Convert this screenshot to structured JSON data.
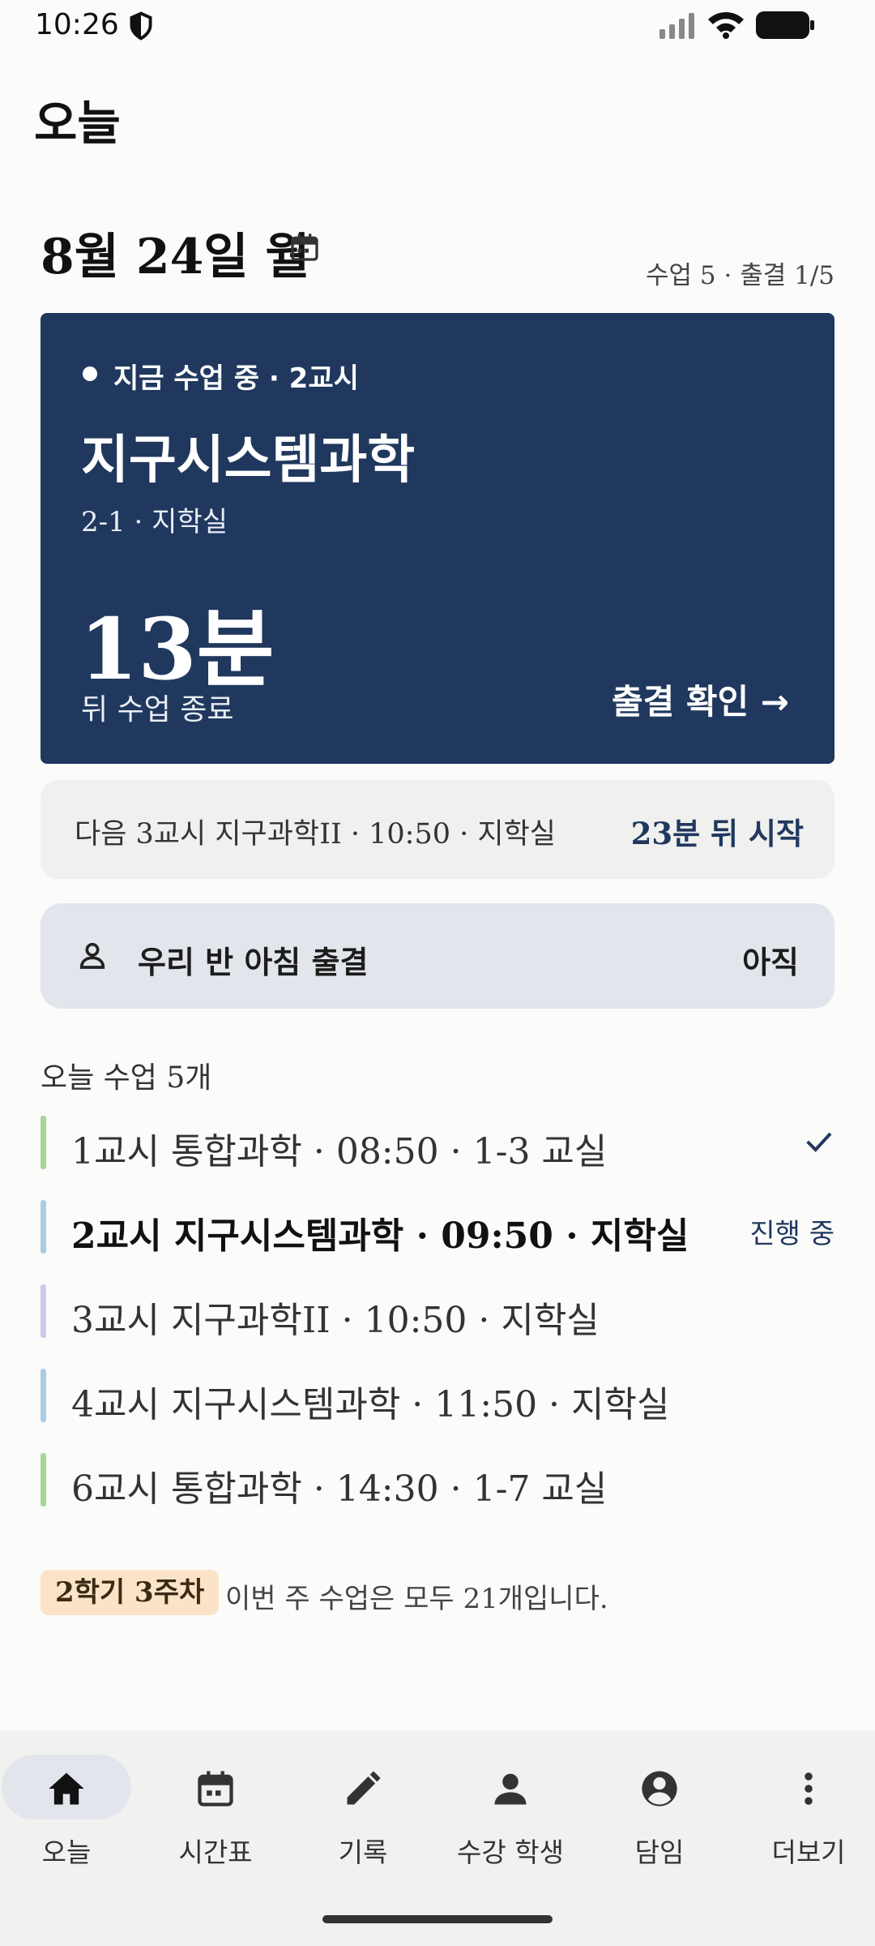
{
  "status_bar": {
    "time": "10:26"
  },
  "header": {
    "title": "오늘"
  },
  "date": {
    "label": "8월 24일 월",
    "summary": "수업 5 · 출결 1/5"
  },
  "current_class": {
    "status": "지금 수업 중 · 2교시",
    "name": "지구시스템과학",
    "room": "2-1 · 지학실",
    "remaining": "13분",
    "remaining_label": "뒤 수업 종료",
    "action": "출결 확인 →"
  },
  "next_class": {
    "text": "다음 3교시 지구과학II · 10:50 · 지학실",
    "start": "23분 뒤 시작"
  },
  "homeroom": {
    "label": "우리 반 아침 출결",
    "status": "아직"
  },
  "schedule": {
    "heading": "오늘 수업 5개",
    "items": [
      {
        "text": "1교시 통합과학 · 08:50 · 1-3 교실",
        "color": "#a8d49a",
        "state": "done"
      },
      {
        "text": "2교시 지구시스템과학 · 09:50 · 지학실",
        "color": "#aacde6",
        "state": "current",
        "state_label": "진행 중"
      },
      {
        "text": "3교시 지구과학II · 10:50 · 지학실",
        "color": "#cfc8ea",
        "state": "upcoming"
      },
      {
        "text": "4교시 지구시스템과학 · 11:50 · 지학실",
        "color": "#aacde6",
        "state": "upcoming"
      },
      {
        "text": "6교시 통합과학 · 14:30 · 1-7 교실",
        "color": "#a8d49a",
        "state": "upcoming"
      }
    ]
  },
  "week": {
    "badge": "2학기 3주차",
    "text": "이번 주 수업은 모두 21개입니다."
  },
  "nav": {
    "items": [
      {
        "label": "오늘",
        "icon": "home-icon",
        "active": true
      },
      {
        "label": "시간표",
        "icon": "calendar-icon"
      },
      {
        "label": "기록",
        "icon": "pencil-icon"
      },
      {
        "label": "수강 학생",
        "icon": "person-icon"
      },
      {
        "label": "담임",
        "icon": "account-circle-icon"
      },
      {
        "label": "더보기",
        "icon": "more-vertical-icon"
      }
    ]
  },
  "colors": {
    "primary": "#20385e",
    "background": "#fbfbf9",
    "badge": "#fbe3c7"
  }
}
